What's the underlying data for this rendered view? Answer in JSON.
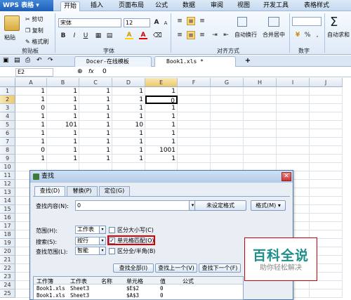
{
  "app": {
    "name": "WPS 表格"
  },
  "menu": {
    "tabs": [
      "开始",
      "插入",
      "页面布局",
      "公式",
      "数据",
      "审阅",
      "视图",
      "开发工具",
      "表格样式"
    ],
    "active": "开始"
  },
  "ribbon": {
    "paste": "粘贴",
    "cut": "剪切",
    "copy": "复制",
    "format_painter": "格式刷",
    "clipboard_group": "剪贴板",
    "font_name": "宋体",
    "font_size": "12",
    "font_group": "字体",
    "bold": "B",
    "italic": "I",
    "underline": "U",
    "font_color_glyph": "A",
    "fill_glyph": "A",
    "grow_font": "A",
    "shrink_font": "A",
    "wrap_text": "自动换行",
    "merge_center": "合并居中",
    "align_group": "对齐方式",
    "percent": "%",
    "number_group": "数字",
    "sum_filter": "自动求和"
  },
  "doc_tabs": [
    {
      "label": "Docer-在线模板"
    },
    {
      "label": "Book1.xls *"
    }
  ],
  "formula_bar": {
    "cell_ref": "E2",
    "fx": "fx",
    "value": "0"
  },
  "sheet": {
    "columns": [
      "A",
      "B",
      "C",
      "D",
      "E",
      "F",
      "G",
      "H",
      "I",
      "J"
    ],
    "rows": [
      [
        "1",
        "1",
        "1",
        "1",
        "1"
      ],
      [
        "1",
        "1",
        "1",
        "1",
        "0"
      ],
      [
        "0",
        "1",
        "1",
        "1",
        "1"
      ],
      [
        "1",
        "1",
        "1",
        "1",
        "1"
      ],
      [
        "1",
        "101",
        "1",
        "10",
        "1"
      ],
      [
        "1",
        "1",
        "1",
        "1",
        "1"
      ],
      [
        "1",
        "1",
        "1",
        "1",
        "1"
      ],
      [
        "0",
        "1",
        "1",
        "1",
        "1001"
      ],
      [
        "1",
        "1",
        "1",
        "1",
        "1"
      ]
    ],
    "row_numbers": [
      "1",
      "2",
      "3",
      "4",
      "5",
      "6",
      "7",
      "8",
      "9",
      "10",
      "11",
      "12",
      "13",
      "14",
      "15",
      "16",
      "17",
      "18",
      "19",
      "20",
      "21",
      "22",
      "23",
      "24",
      "25"
    ],
    "selected_cell": "E2"
  },
  "dialog": {
    "title": "查找",
    "tabs": [
      "查找(D)",
      "替换(P)",
      "定位(G)"
    ],
    "find_label": "查找内容(N):",
    "find_value": "0",
    "no_format_btn": "未设定格式",
    "format_btn": "格式(M)",
    "scope_label": "范围(H):",
    "scope_value": "工作表",
    "search_label": "搜索(S):",
    "search_value": "按行",
    "look_in_label": "查找范围(L):",
    "look_in_value": "智能",
    "match_case": "区分大小写(C)",
    "match_cell": "单元格匹配(O)",
    "match_width": "区分全/半角(B)",
    "find_all_btn": "查找全部(I)",
    "find_prev_btn": "查找上一个(V)",
    "find_next_btn": "查找下一个(F)",
    "results": {
      "headers": [
        "工作簿",
        "工作表",
        "名称",
        "单元格",
        "值",
        "公式"
      ],
      "rows": [
        [
          "Book1.xls",
          "Sheet3",
          "",
          "$E$2",
          "0",
          ""
        ],
        [
          "Book1.xls",
          "Sheet3",
          "",
          "$A$3",
          "0",
          ""
        ]
      ]
    }
  },
  "watermark": {
    "title": "百科全说",
    "subtitle": "助你轻松解决"
  }
}
